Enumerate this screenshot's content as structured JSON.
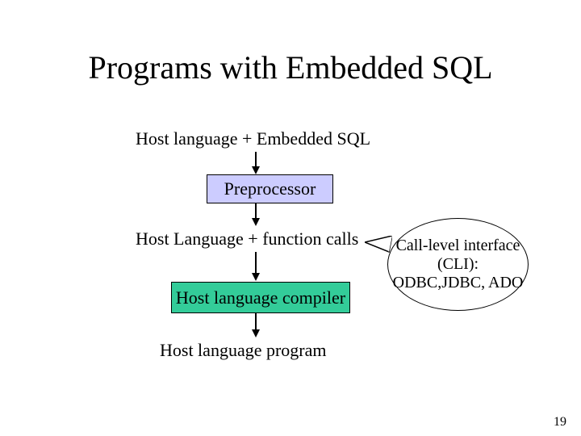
{
  "title": "Programs with Embedded SQL",
  "steps": {
    "s1": "Host language  +  Embedded SQL",
    "box1": "Preprocessor",
    "s2": "Host Language + function calls",
    "box2": "Host language compiler",
    "s3": "Host language program"
  },
  "callout": "Call-level interface (CLI): ODBC,JDBC, ADO",
  "pagenum": "19"
}
